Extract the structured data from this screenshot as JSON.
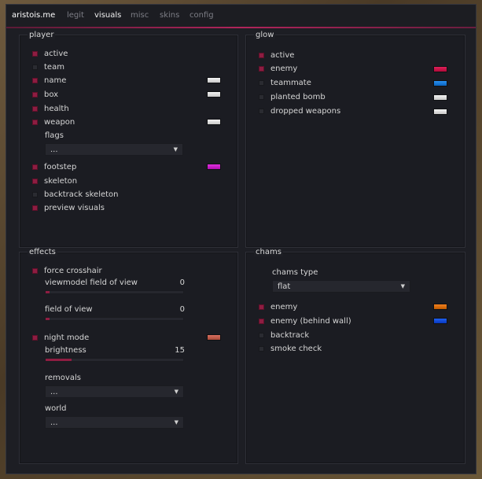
{
  "header": {
    "brand": "aristois.me",
    "tabs": [
      {
        "label": "legit",
        "active": false
      },
      {
        "label": "visuals",
        "active": true
      },
      {
        "label": "misc",
        "active": false
      },
      {
        "label": "skins",
        "active": false
      },
      {
        "label": "config",
        "active": false
      }
    ],
    "accent_color": "#b0245a"
  },
  "player": {
    "title": "player",
    "items": [
      {
        "label": "active",
        "checked": true
      },
      {
        "label": "team",
        "checked": false
      },
      {
        "label": "name",
        "checked": true,
        "color": "#e6e6e6"
      },
      {
        "label": "box",
        "checked": true,
        "color": "#e6e6e6"
      },
      {
        "label": "health",
        "checked": true
      },
      {
        "label": "weapon",
        "checked": true,
        "color": "#e6e6e6"
      }
    ],
    "flags_label": "flags",
    "flags_value": "...",
    "items2": [
      {
        "label": "footstep",
        "checked": true,
        "color": "#d21ad2"
      },
      {
        "label": "skeleton",
        "checked": true
      },
      {
        "label": "backtrack skeleton",
        "checked": false
      },
      {
        "label": "preview visuals",
        "checked": true
      }
    ]
  },
  "glow": {
    "title": "glow",
    "items": [
      {
        "label": "active",
        "checked": true
      },
      {
        "label": "enemy",
        "checked": true,
        "color": "#d0104a"
      },
      {
        "label": "teammate",
        "checked": false,
        "color": "#1a7ee0"
      },
      {
        "label": "planted bomb",
        "checked": false,
        "color": "#e6e6e6"
      },
      {
        "label": "dropped weapons",
        "checked": false,
        "color": "#e6e6e6"
      }
    ]
  },
  "effects": {
    "title": "effects",
    "force_crosshair": {
      "label": "force crosshair",
      "checked": true
    },
    "viewmodel_fov": {
      "label": "viewmodel field of view",
      "value": "0",
      "fraction": 0.03
    },
    "fov": {
      "label": "field of view",
      "value": "0",
      "fraction": 0.03
    },
    "night_mode": {
      "label": "night mode",
      "checked": true,
      "color": "#c0604a"
    },
    "brightness": {
      "label": "brightness",
      "value": "15",
      "fraction": 0.19
    },
    "removals_label": "removals",
    "removals_value": "...",
    "world_label": "world",
    "world_value": "..."
  },
  "chams": {
    "title": "chams",
    "type_label": "chams type",
    "type_value": "flat",
    "items": [
      {
        "label": "enemy",
        "checked": true,
        "color": "#e07010"
      },
      {
        "label": "enemy (behind wall)",
        "checked": true,
        "color": "#1050e0"
      },
      {
        "label": "backtrack",
        "checked": false
      },
      {
        "label": "smoke check",
        "checked": false
      }
    ]
  }
}
